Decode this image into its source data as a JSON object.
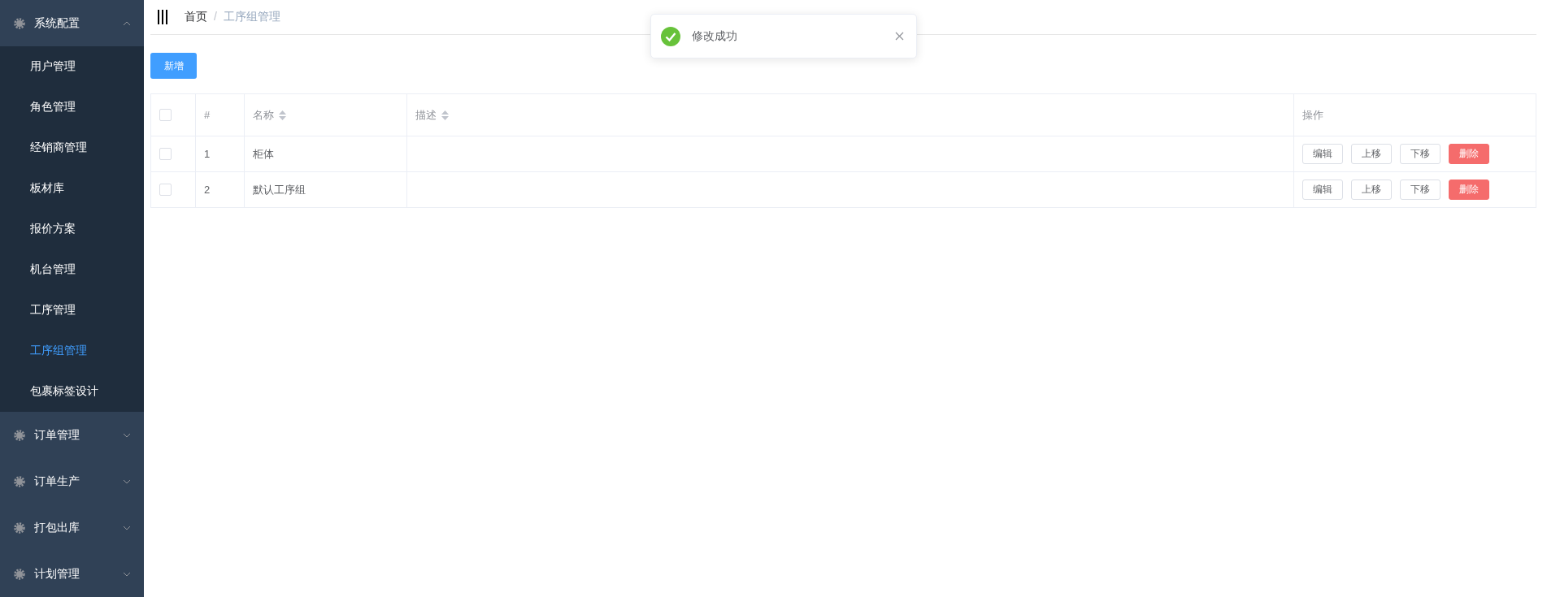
{
  "sidebar": {
    "groups": [
      {
        "label": "系统配置",
        "expanded": true,
        "items": [
          {
            "label": "用户管理",
            "selected": false
          },
          {
            "label": "角色管理",
            "selected": false
          },
          {
            "label": "经销商管理",
            "selected": false
          },
          {
            "label": "板材库",
            "selected": false
          },
          {
            "label": "报价方案",
            "selected": false
          },
          {
            "label": "机台管理",
            "selected": false
          },
          {
            "label": "工序管理",
            "selected": false
          },
          {
            "label": "工序组管理",
            "selected": true
          },
          {
            "label": "包裹标签设计",
            "selected": false
          }
        ]
      },
      {
        "label": "订单管理",
        "expanded": false
      },
      {
        "label": "订单生产",
        "expanded": false
      },
      {
        "label": "打包出库",
        "expanded": false
      },
      {
        "label": "计划管理",
        "expanded": false
      }
    ]
  },
  "breadcrumb": [
    "首页",
    "/",
    "工序组管理"
  ],
  "toast": {
    "message": "修改成功"
  },
  "toolbar": {
    "add_button": "新增"
  },
  "table": {
    "header_checked": false,
    "columns": [
      {
        "label": "#",
        "sortable": false
      },
      {
        "label": "名称",
        "sortable": true
      },
      {
        "label": "描述",
        "sortable": true
      },
      {
        "label": "操作",
        "sortable": false
      }
    ],
    "rows": [
      {
        "checked": false,
        "index": "1",
        "name": "柜体",
        "actions": [
          "编辑",
          "上移",
          "下移",
          "删除"
        ]
      },
      {
        "checked": false,
        "index": "2",
        "name": "默认工序组",
        "actions": [
          "编辑",
          "上移",
          "下移",
          "删除"
        ]
      }
    ]
  }
}
